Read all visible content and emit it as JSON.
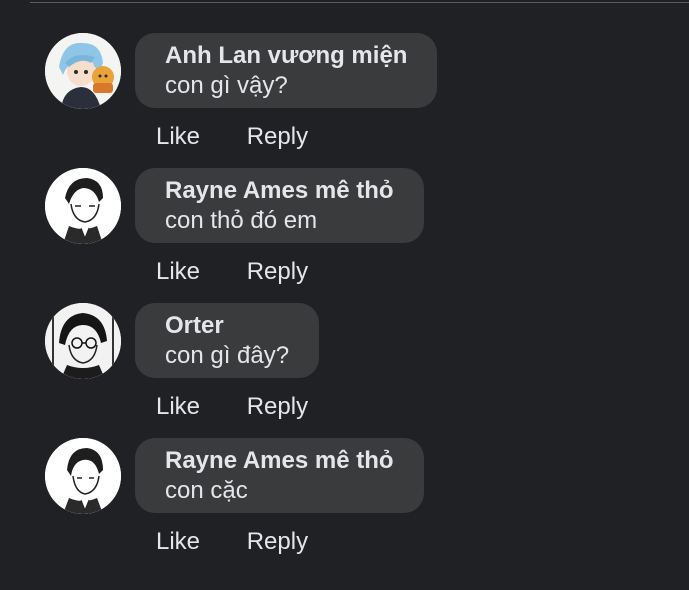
{
  "comments": [
    {
      "author": "Anh Lan vương miện",
      "text": "con gì vậy?",
      "like_label": "Like",
      "reply_label": "Reply"
    },
    {
      "author": "Rayne Ames mê thỏ",
      "text": "con thỏ đó em",
      "like_label": "Like",
      "reply_label": "Reply"
    },
    {
      "author": "Orter",
      "text": "con gì đây?",
      "like_label": "Like",
      "reply_label": "Reply"
    },
    {
      "author": "Rayne Ames mê thỏ",
      "text": "con cặc",
      "like_label": "Like",
      "reply_label": "Reply"
    }
  ],
  "colors": {
    "background": "#202124",
    "bubble": "#3a3b3c",
    "text": "#e4e6eb"
  }
}
